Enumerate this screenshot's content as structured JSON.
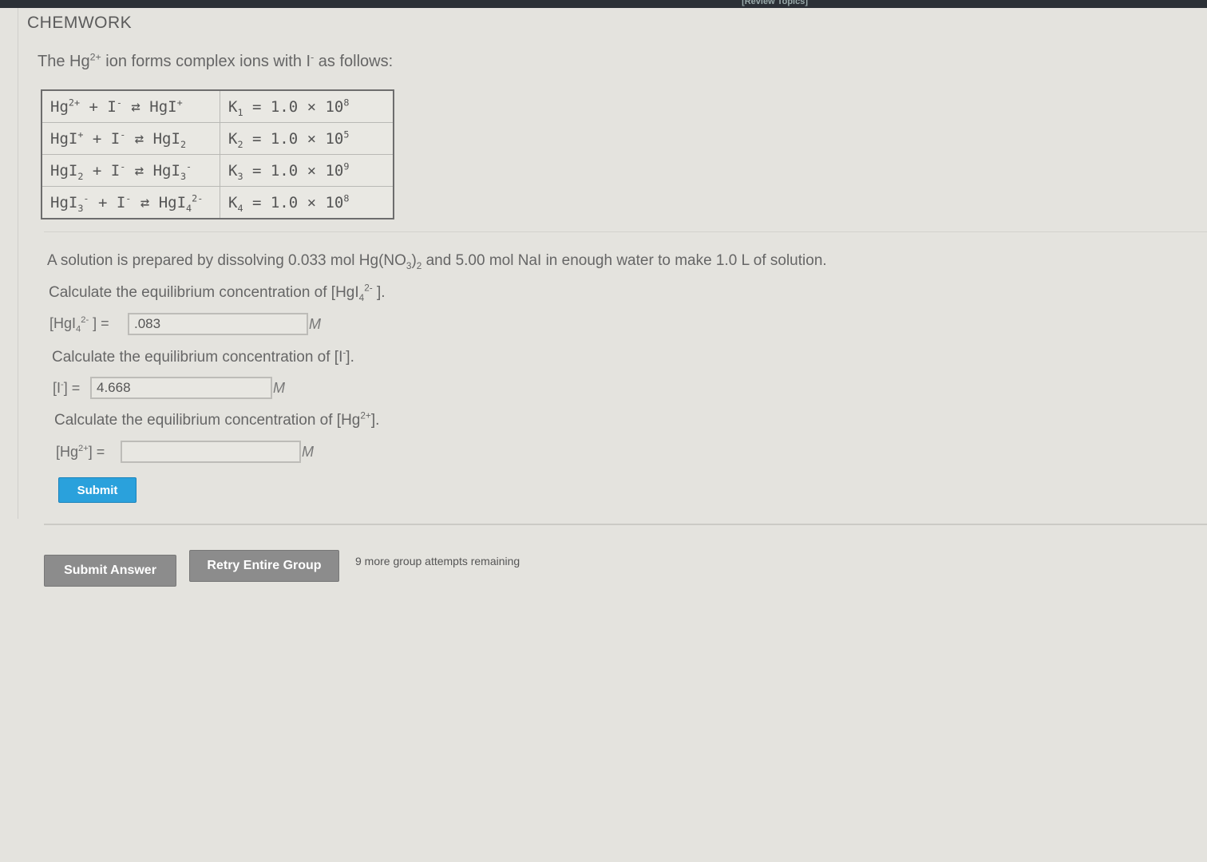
{
  "header": {
    "title": "CHEMWORK",
    "review_link": "[Review Topics]"
  },
  "intro": {
    "pre": "The Hg",
    "sup": "2+",
    "mid": " ion forms complex ions with I",
    "sup2": "-",
    "post": " as follows:"
  },
  "equilibria": [
    {
      "reactant": "Hg",
      "reactant_sup": "2+",
      "reactant_sub": "",
      "plus": " + I",
      "arrow": " ⇄ ",
      "product": "HgI",
      "product_sub": "",
      "product_sup": "+",
      "k_label": "K",
      "k_sub": "1",
      "k_value": " = 1.0 × 10",
      "k_exp": "8"
    },
    {
      "reactant": "HgI",
      "reactant_sup": "+",
      "reactant_sub": "",
      "plus": " + I",
      "arrow": " ⇄ ",
      "product": "HgI",
      "product_sub": "2",
      "product_sup": "",
      "k_label": "K",
      "k_sub": "2",
      "k_value": " = 1.0 × 10",
      "k_exp": "5"
    },
    {
      "reactant": "HgI",
      "reactant_sup": "",
      "reactant_sub": "2",
      "plus": " + I",
      "arrow": " ⇄ ",
      "product": "HgI",
      "product_sub": "3",
      "product_sup": "-",
      "k_label": "K",
      "k_sub": "3",
      "k_value": " = 1.0 × 10",
      "k_exp": "9"
    },
    {
      "reactant": "HgI",
      "reactant_sup": "-",
      "reactant_sub": "3",
      "plus": " + I",
      "arrow": " ⇄ ",
      "product": "HgI",
      "product_sub": "4",
      "product_sup": "2-",
      "k_label": "K",
      "k_sub": "4",
      "k_value": " = 1.0 × 10",
      "k_exp": "8"
    }
  ],
  "problem": {
    "statement_pre": "A solution is prepared by dissolving 0.033 mol Hg(NO",
    "statement_sub": "3",
    "statement_mid": ")",
    "statement_sub2": "2",
    "statement_post": " and 5.00 mol NaI in enough water to make 1.0 L of solution.",
    "q1_pre": "Calculate the equilibrium concentration of [HgI",
    "q1_sub": "4",
    "q1_sup": "2-",
    "q1_post": " ].",
    "a1_label_pre": "[HgI",
    "a1_label_sub": "4",
    "a1_label_sup": "2-",
    "a1_label_post": " ] =",
    "a1_value": ".083",
    "q2_pre": "Calculate the equilibrium concentration of [I",
    "q2_sup": "-",
    "q2_post": "].",
    "a2_label_pre": "[I",
    "a2_label_sup": "-",
    "a2_label_post": "] =",
    "a2_value": "4.668",
    "q3_pre": "Calculate the equilibrium concentration of [Hg",
    "q3_sup": "2+",
    "q3_post": "].",
    "a3_label_pre": "[Hg",
    "a3_label_sup": "2+",
    "a3_label_post": "] =",
    "a3_value": "",
    "unit": "M",
    "submit_label": "Submit"
  },
  "footer": {
    "submit_answer_label": "Submit Answer",
    "retry_label": "Retry Entire Group",
    "attempts_text": "9 more group attempts remaining"
  },
  "colors": {
    "accent": "#2aa1dc",
    "gray_button": "#8c8c8c",
    "background": "#e4e3de"
  }
}
